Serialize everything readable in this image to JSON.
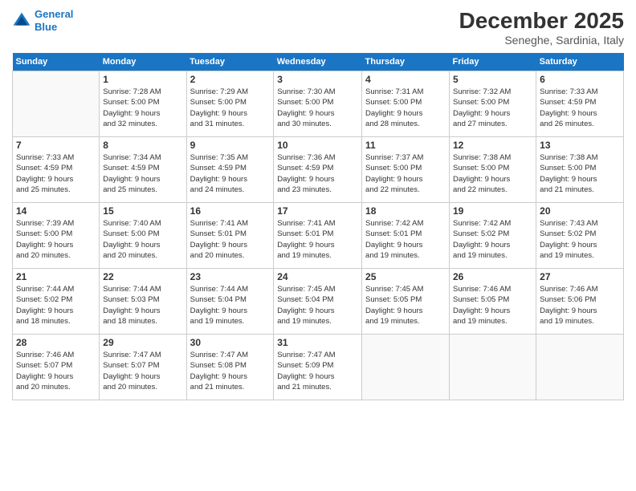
{
  "header": {
    "logo_line1": "General",
    "logo_line2": "Blue",
    "month": "December 2025",
    "location": "Seneghe, Sardinia, Italy"
  },
  "weekdays": [
    "Sunday",
    "Monday",
    "Tuesday",
    "Wednesday",
    "Thursday",
    "Friday",
    "Saturday"
  ],
  "weeks": [
    [
      {
        "day": "",
        "info": ""
      },
      {
        "day": "1",
        "info": "Sunrise: 7:28 AM\nSunset: 5:00 PM\nDaylight: 9 hours\nand 32 minutes."
      },
      {
        "day": "2",
        "info": "Sunrise: 7:29 AM\nSunset: 5:00 PM\nDaylight: 9 hours\nand 31 minutes."
      },
      {
        "day": "3",
        "info": "Sunrise: 7:30 AM\nSunset: 5:00 PM\nDaylight: 9 hours\nand 30 minutes."
      },
      {
        "day": "4",
        "info": "Sunrise: 7:31 AM\nSunset: 5:00 PM\nDaylight: 9 hours\nand 28 minutes."
      },
      {
        "day": "5",
        "info": "Sunrise: 7:32 AM\nSunset: 5:00 PM\nDaylight: 9 hours\nand 27 minutes."
      },
      {
        "day": "6",
        "info": "Sunrise: 7:33 AM\nSunset: 4:59 PM\nDaylight: 9 hours\nand 26 minutes."
      }
    ],
    [
      {
        "day": "7",
        "info": "Sunrise: 7:33 AM\nSunset: 4:59 PM\nDaylight: 9 hours\nand 25 minutes."
      },
      {
        "day": "8",
        "info": "Sunrise: 7:34 AM\nSunset: 4:59 PM\nDaylight: 9 hours\nand 25 minutes."
      },
      {
        "day": "9",
        "info": "Sunrise: 7:35 AM\nSunset: 4:59 PM\nDaylight: 9 hours\nand 24 minutes."
      },
      {
        "day": "10",
        "info": "Sunrise: 7:36 AM\nSunset: 4:59 PM\nDaylight: 9 hours\nand 23 minutes."
      },
      {
        "day": "11",
        "info": "Sunrise: 7:37 AM\nSunset: 5:00 PM\nDaylight: 9 hours\nand 22 minutes."
      },
      {
        "day": "12",
        "info": "Sunrise: 7:38 AM\nSunset: 5:00 PM\nDaylight: 9 hours\nand 22 minutes."
      },
      {
        "day": "13",
        "info": "Sunrise: 7:38 AM\nSunset: 5:00 PM\nDaylight: 9 hours\nand 21 minutes."
      }
    ],
    [
      {
        "day": "14",
        "info": "Sunrise: 7:39 AM\nSunset: 5:00 PM\nDaylight: 9 hours\nand 20 minutes."
      },
      {
        "day": "15",
        "info": "Sunrise: 7:40 AM\nSunset: 5:00 PM\nDaylight: 9 hours\nand 20 minutes."
      },
      {
        "day": "16",
        "info": "Sunrise: 7:41 AM\nSunset: 5:01 PM\nDaylight: 9 hours\nand 20 minutes."
      },
      {
        "day": "17",
        "info": "Sunrise: 7:41 AM\nSunset: 5:01 PM\nDaylight: 9 hours\nand 19 minutes."
      },
      {
        "day": "18",
        "info": "Sunrise: 7:42 AM\nSunset: 5:01 PM\nDaylight: 9 hours\nand 19 minutes."
      },
      {
        "day": "19",
        "info": "Sunrise: 7:42 AM\nSunset: 5:02 PM\nDaylight: 9 hours\nand 19 minutes."
      },
      {
        "day": "20",
        "info": "Sunrise: 7:43 AM\nSunset: 5:02 PM\nDaylight: 9 hours\nand 19 minutes."
      }
    ],
    [
      {
        "day": "21",
        "info": "Sunrise: 7:44 AM\nSunset: 5:02 PM\nDaylight: 9 hours\nand 18 minutes."
      },
      {
        "day": "22",
        "info": "Sunrise: 7:44 AM\nSunset: 5:03 PM\nDaylight: 9 hours\nand 18 minutes."
      },
      {
        "day": "23",
        "info": "Sunrise: 7:44 AM\nSunset: 5:04 PM\nDaylight: 9 hours\nand 19 minutes."
      },
      {
        "day": "24",
        "info": "Sunrise: 7:45 AM\nSunset: 5:04 PM\nDaylight: 9 hours\nand 19 minutes."
      },
      {
        "day": "25",
        "info": "Sunrise: 7:45 AM\nSunset: 5:05 PM\nDaylight: 9 hours\nand 19 minutes."
      },
      {
        "day": "26",
        "info": "Sunrise: 7:46 AM\nSunset: 5:05 PM\nDaylight: 9 hours\nand 19 minutes."
      },
      {
        "day": "27",
        "info": "Sunrise: 7:46 AM\nSunset: 5:06 PM\nDaylight: 9 hours\nand 19 minutes."
      }
    ],
    [
      {
        "day": "28",
        "info": "Sunrise: 7:46 AM\nSunset: 5:07 PM\nDaylight: 9 hours\nand 20 minutes."
      },
      {
        "day": "29",
        "info": "Sunrise: 7:47 AM\nSunset: 5:07 PM\nDaylight: 9 hours\nand 20 minutes."
      },
      {
        "day": "30",
        "info": "Sunrise: 7:47 AM\nSunset: 5:08 PM\nDaylight: 9 hours\nand 21 minutes."
      },
      {
        "day": "31",
        "info": "Sunrise: 7:47 AM\nSunset: 5:09 PM\nDaylight: 9 hours\nand 21 minutes."
      },
      {
        "day": "",
        "info": ""
      },
      {
        "day": "",
        "info": ""
      },
      {
        "day": "",
        "info": ""
      }
    ]
  ]
}
